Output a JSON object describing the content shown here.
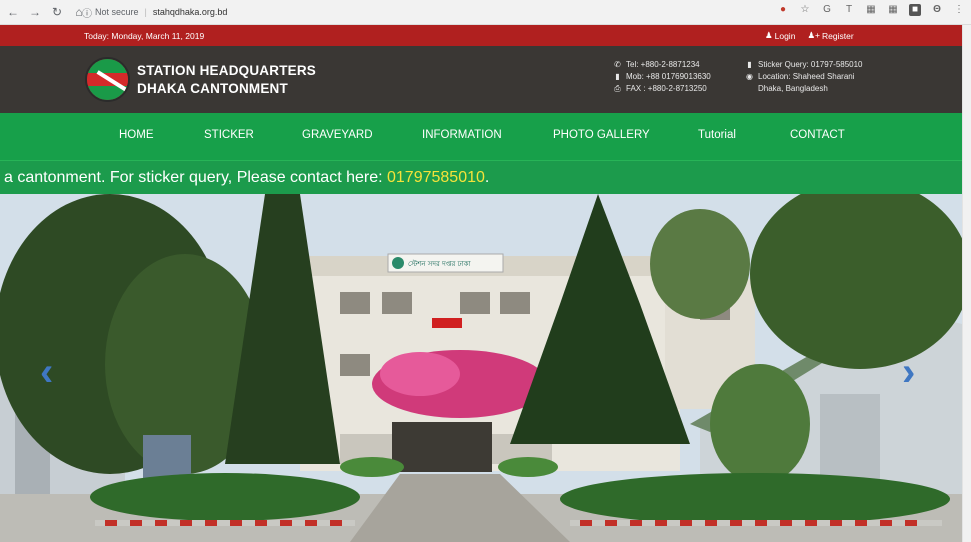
{
  "browser": {
    "security_label": "Not secure",
    "url": "stahqdhaka.org.bd"
  },
  "topbar": {
    "date": "Today: Monday, March 11, 2019",
    "login": "Login",
    "register": "Register"
  },
  "header": {
    "title_line1": "STATION HEADQUARTERS",
    "title_line2": "DHAKA CANTONMENT",
    "tel": "Tel: +880-2-8871234",
    "mob": "Mob: +88 01769013630",
    "fax": "FAX : +880-2-8713250",
    "sticker_query": "Sticker Query: 01797-585010",
    "location_line1": "Location: Shaheed Sharani",
    "location_line2": "Dhaka, Bangladesh"
  },
  "nav": {
    "items": [
      "HOME",
      "STICKER",
      "GRAVEYARD",
      "INFORMATION",
      "PHOTO GALLERY",
      "Tutorial",
      "CONTACT"
    ]
  },
  "ticker": {
    "text": "a cantonment. For sticker query, Please contact here: ",
    "phone": "01797585010",
    "end": "."
  },
  "hero": {
    "building_sign": "স্টেশন সদর দপ্তর ঢাকা"
  },
  "colors": {
    "topbar": "#b0201f",
    "header": "#3a3734",
    "nav": "#17a04a",
    "ticker_phone": "#f5e33a"
  }
}
